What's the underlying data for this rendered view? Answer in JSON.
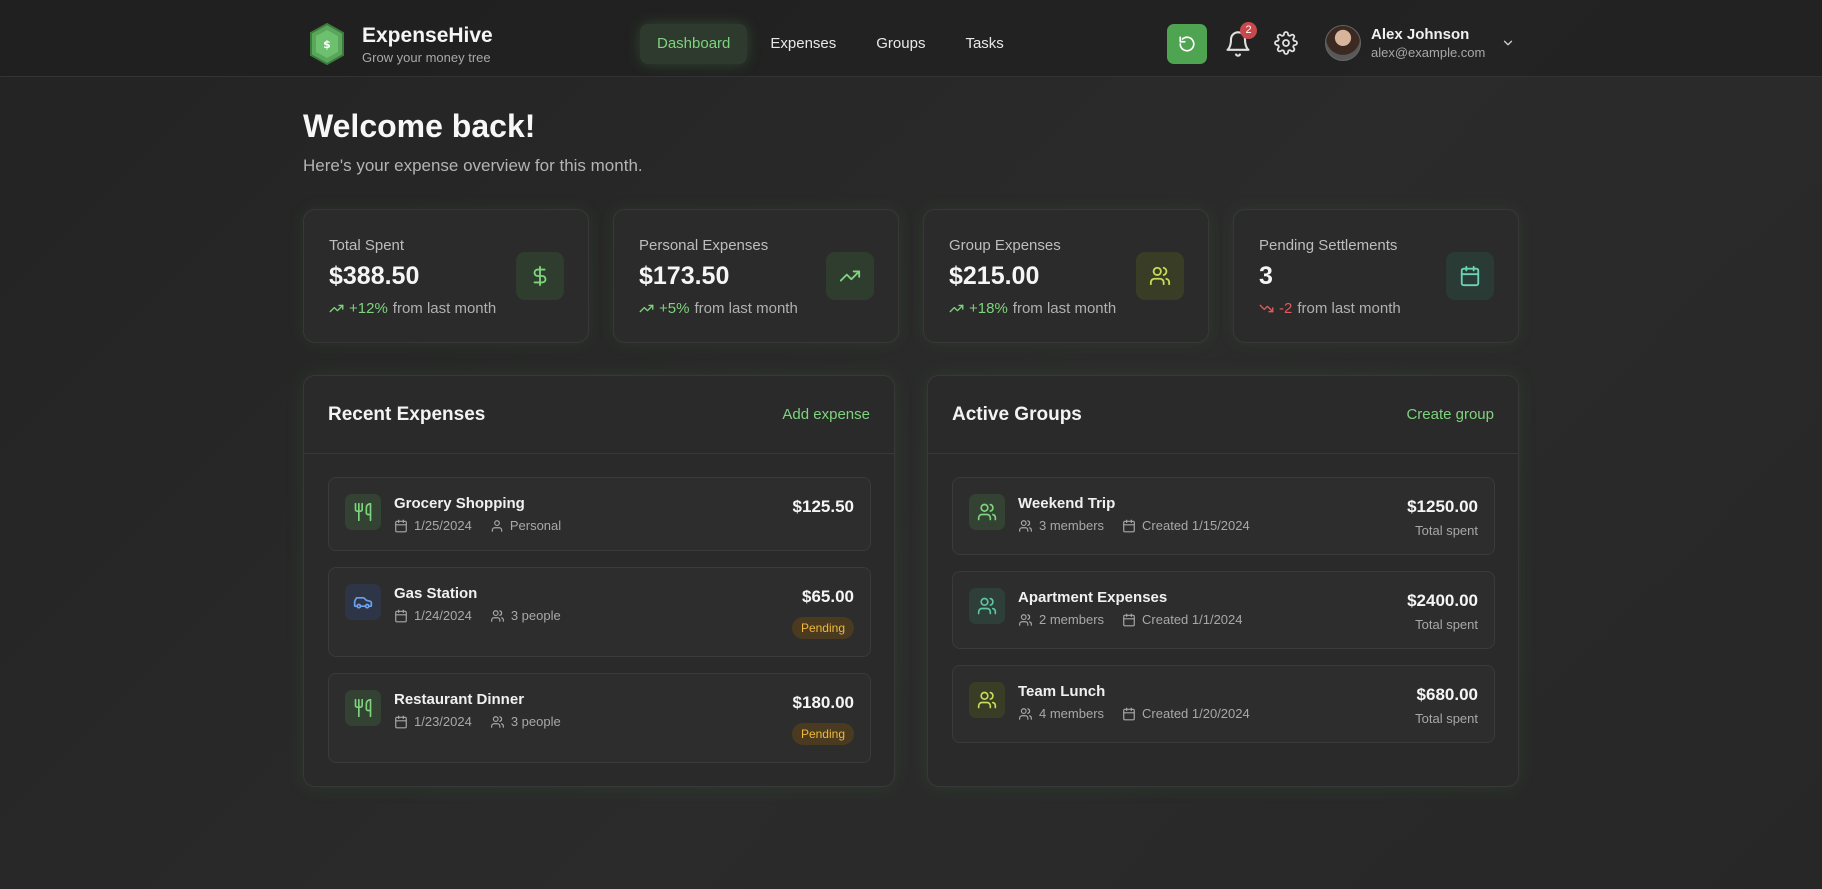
{
  "brand": {
    "name": "ExpenseHive",
    "tagline": "Grow your money tree"
  },
  "nav": [
    {
      "label": "Dashboard",
      "active": true
    },
    {
      "label": "Expenses",
      "active": false
    },
    {
      "label": "Groups",
      "active": false
    },
    {
      "label": "Tasks",
      "active": false
    }
  ],
  "notifications": {
    "count": "2"
  },
  "user": {
    "name": "Alex Johnson",
    "email": "alex@example.com"
  },
  "welcome": {
    "title": "Welcome back!",
    "subtitle": "Here's your expense overview for this month."
  },
  "stats": [
    {
      "label": "Total Spent",
      "value": "$388.50",
      "change": "+12%",
      "change_suffix": "from last month",
      "trend": "up",
      "icon": "dollar-icon"
    },
    {
      "label": "Personal Expenses",
      "value": "$173.50",
      "change": "+5%",
      "change_suffix": "from last month",
      "trend": "up",
      "icon": "trending-up-icon"
    },
    {
      "label": "Group Expenses",
      "value": "$215.00",
      "change": "+18%",
      "change_suffix": "from last month",
      "trend": "up",
      "icon": "users-icon"
    },
    {
      "label": "Pending Settlements",
      "value": "3",
      "change": "-2",
      "change_suffix": "from last month",
      "trend": "down",
      "icon": "calendar-icon"
    }
  ],
  "recent_expenses": {
    "title": "Recent Expenses",
    "action": "Add expense",
    "items": [
      {
        "title": "Grocery Shopping",
        "date": "1/25/2024",
        "scope": "Personal",
        "amount": "$125.50",
        "status": "",
        "icon": "utensils-icon"
      },
      {
        "title": "Gas Station",
        "date": "1/24/2024",
        "scope": "3 people",
        "amount": "$65.00",
        "status": "Pending",
        "icon": "car-icon"
      },
      {
        "title": "Restaurant Dinner",
        "date": "1/23/2024",
        "scope": "3 people",
        "amount": "$180.00",
        "status": "Pending",
        "icon": "utensils-icon"
      }
    ]
  },
  "active_groups": {
    "title": "Active Groups",
    "action": "Create group",
    "items": [
      {
        "title": "Weekend Trip",
        "members": "3 members",
        "created": "Created 1/15/2024",
        "amount": "$1250.00",
        "sub": "Total spent"
      },
      {
        "title": "Apartment Expenses",
        "members": "2 members",
        "created": "Created 1/1/2024",
        "amount": "$2400.00",
        "sub": "Total spent"
      },
      {
        "title": "Team Lunch",
        "members": "4 members",
        "created": "Created 1/20/2024",
        "amount": "$680.00",
        "sub": "Total spent"
      }
    ]
  },
  "colors": {
    "accent": "#7ed37e",
    "accent_button": "#4fa452",
    "negative": "#e05b5b",
    "pending": "#f0b93a"
  }
}
